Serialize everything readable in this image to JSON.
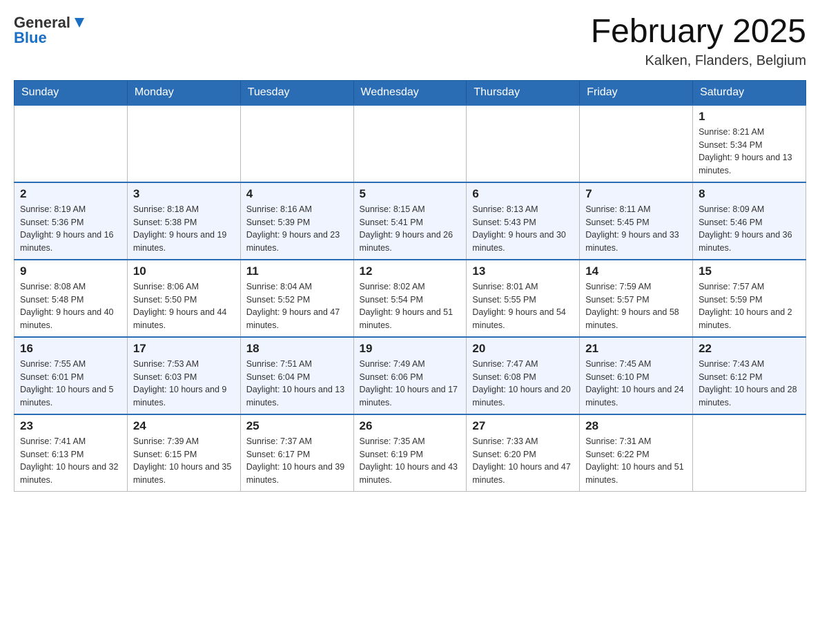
{
  "header": {
    "logo_general": "General",
    "logo_blue": "Blue",
    "title": "February 2025",
    "location": "Kalken, Flanders, Belgium"
  },
  "days_of_week": [
    "Sunday",
    "Monday",
    "Tuesday",
    "Wednesday",
    "Thursday",
    "Friday",
    "Saturday"
  ],
  "weeks": [
    [
      {
        "day": "",
        "info": ""
      },
      {
        "day": "",
        "info": ""
      },
      {
        "day": "",
        "info": ""
      },
      {
        "day": "",
        "info": ""
      },
      {
        "day": "",
        "info": ""
      },
      {
        "day": "",
        "info": ""
      },
      {
        "day": "1",
        "info": "Sunrise: 8:21 AM\nSunset: 5:34 PM\nDaylight: 9 hours and 13 minutes."
      }
    ],
    [
      {
        "day": "2",
        "info": "Sunrise: 8:19 AM\nSunset: 5:36 PM\nDaylight: 9 hours and 16 minutes."
      },
      {
        "day": "3",
        "info": "Sunrise: 8:18 AM\nSunset: 5:38 PM\nDaylight: 9 hours and 19 minutes."
      },
      {
        "day": "4",
        "info": "Sunrise: 8:16 AM\nSunset: 5:39 PM\nDaylight: 9 hours and 23 minutes."
      },
      {
        "day": "5",
        "info": "Sunrise: 8:15 AM\nSunset: 5:41 PM\nDaylight: 9 hours and 26 minutes."
      },
      {
        "day": "6",
        "info": "Sunrise: 8:13 AM\nSunset: 5:43 PM\nDaylight: 9 hours and 30 minutes."
      },
      {
        "day": "7",
        "info": "Sunrise: 8:11 AM\nSunset: 5:45 PM\nDaylight: 9 hours and 33 minutes."
      },
      {
        "day": "8",
        "info": "Sunrise: 8:09 AM\nSunset: 5:46 PM\nDaylight: 9 hours and 36 minutes."
      }
    ],
    [
      {
        "day": "9",
        "info": "Sunrise: 8:08 AM\nSunset: 5:48 PM\nDaylight: 9 hours and 40 minutes."
      },
      {
        "day": "10",
        "info": "Sunrise: 8:06 AM\nSunset: 5:50 PM\nDaylight: 9 hours and 44 minutes."
      },
      {
        "day": "11",
        "info": "Sunrise: 8:04 AM\nSunset: 5:52 PM\nDaylight: 9 hours and 47 minutes."
      },
      {
        "day": "12",
        "info": "Sunrise: 8:02 AM\nSunset: 5:54 PM\nDaylight: 9 hours and 51 minutes."
      },
      {
        "day": "13",
        "info": "Sunrise: 8:01 AM\nSunset: 5:55 PM\nDaylight: 9 hours and 54 minutes."
      },
      {
        "day": "14",
        "info": "Sunrise: 7:59 AM\nSunset: 5:57 PM\nDaylight: 9 hours and 58 minutes."
      },
      {
        "day": "15",
        "info": "Sunrise: 7:57 AM\nSunset: 5:59 PM\nDaylight: 10 hours and 2 minutes."
      }
    ],
    [
      {
        "day": "16",
        "info": "Sunrise: 7:55 AM\nSunset: 6:01 PM\nDaylight: 10 hours and 5 minutes."
      },
      {
        "day": "17",
        "info": "Sunrise: 7:53 AM\nSunset: 6:03 PM\nDaylight: 10 hours and 9 minutes."
      },
      {
        "day": "18",
        "info": "Sunrise: 7:51 AM\nSunset: 6:04 PM\nDaylight: 10 hours and 13 minutes."
      },
      {
        "day": "19",
        "info": "Sunrise: 7:49 AM\nSunset: 6:06 PM\nDaylight: 10 hours and 17 minutes."
      },
      {
        "day": "20",
        "info": "Sunrise: 7:47 AM\nSunset: 6:08 PM\nDaylight: 10 hours and 20 minutes."
      },
      {
        "day": "21",
        "info": "Sunrise: 7:45 AM\nSunset: 6:10 PM\nDaylight: 10 hours and 24 minutes."
      },
      {
        "day": "22",
        "info": "Sunrise: 7:43 AM\nSunset: 6:12 PM\nDaylight: 10 hours and 28 minutes."
      }
    ],
    [
      {
        "day": "23",
        "info": "Sunrise: 7:41 AM\nSunset: 6:13 PM\nDaylight: 10 hours and 32 minutes."
      },
      {
        "day": "24",
        "info": "Sunrise: 7:39 AM\nSunset: 6:15 PM\nDaylight: 10 hours and 35 minutes."
      },
      {
        "day": "25",
        "info": "Sunrise: 7:37 AM\nSunset: 6:17 PM\nDaylight: 10 hours and 39 minutes."
      },
      {
        "day": "26",
        "info": "Sunrise: 7:35 AM\nSunset: 6:19 PM\nDaylight: 10 hours and 43 minutes."
      },
      {
        "day": "27",
        "info": "Sunrise: 7:33 AM\nSunset: 6:20 PM\nDaylight: 10 hours and 47 minutes."
      },
      {
        "day": "28",
        "info": "Sunrise: 7:31 AM\nSunset: 6:22 PM\nDaylight: 10 hours and 51 minutes."
      },
      {
        "day": "",
        "info": ""
      }
    ]
  ]
}
